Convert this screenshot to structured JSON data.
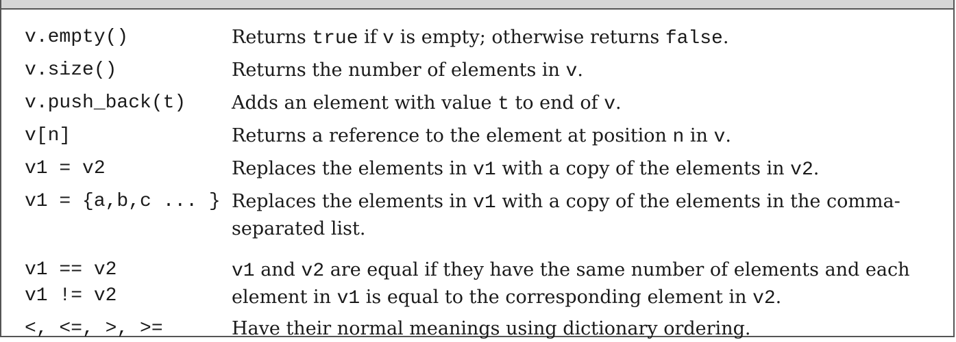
{
  "rows": [
    {
      "op": "v.empty()",
      "desc": [
        {
          "t": "Returns "
        },
        {
          "t": "true",
          "c": 1
        },
        {
          "t": " if "
        },
        {
          "t": "v",
          "c": 1
        },
        {
          "t": " is empty; otherwise returns "
        },
        {
          "t": "false",
          "c": 1
        },
        {
          "t": "."
        }
      ]
    },
    {
      "op": "v.size()",
      "desc": [
        {
          "t": "Returns the number of elements in "
        },
        {
          "t": "v",
          "c": 1
        },
        {
          "t": "."
        }
      ]
    },
    {
      "op": "v.push_back(t)",
      "desc": [
        {
          "t": "Adds an element with value "
        },
        {
          "t": "t",
          "c": 1
        },
        {
          "t": " to end of "
        },
        {
          "t": "v",
          "c": 1
        },
        {
          "t": "."
        }
      ]
    },
    {
      "op": "v[n]",
      "desc": [
        {
          "t": "Returns a reference to the element at position "
        },
        {
          "t": "n",
          "c": 1
        },
        {
          "t": " in "
        },
        {
          "t": "v",
          "c": 1
        },
        {
          "t": "."
        }
      ]
    },
    {
      "op": "v1 = v2",
      "desc": [
        {
          "t": "Replaces the elements in "
        },
        {
          "t": "v1",
          "c": 1
        },
        {
          "t": " with a copy of the elements in "
        },
        {
          "t": "v2",
          "c": 1
        },
        {
          "t": "."
        }
      ]
    },
    {
      "op": "v1 = {a,b,c ... }",
      "desc": [
        {
          "t": "Replaces the elements in "
        },
        {
          "t": "v1",
          "c": 1
        },
        {
          "t": " with a copy of the elements in the comma-separated list."
        }
      ]
    },
    {
      "op": "v1 == v2\nv1 != v2",
      "desc": [
        {
          "t": "v1",
          "c": 1
        },
        {
          "t": " and "
        },
        {
          "t": "v2",
          "c": 1
        },
        {
          "t": " are equal if they have the same number of elements and each element in "
        },
        {
          "t": "v1",
          "c": 1
        },
        {
          "t": " is equal to the corresponding element in "
        },
        {
          "t": "v2",
          "c": 1
        },
        {
          "t": "."
        }
      ]
    },
    {
      "op": "<, <=, >, >=",
      "desc": [
        {
          "t": "Have their normal meanings using dictionary ordering."
        }
      ]
    }
  ]
}
